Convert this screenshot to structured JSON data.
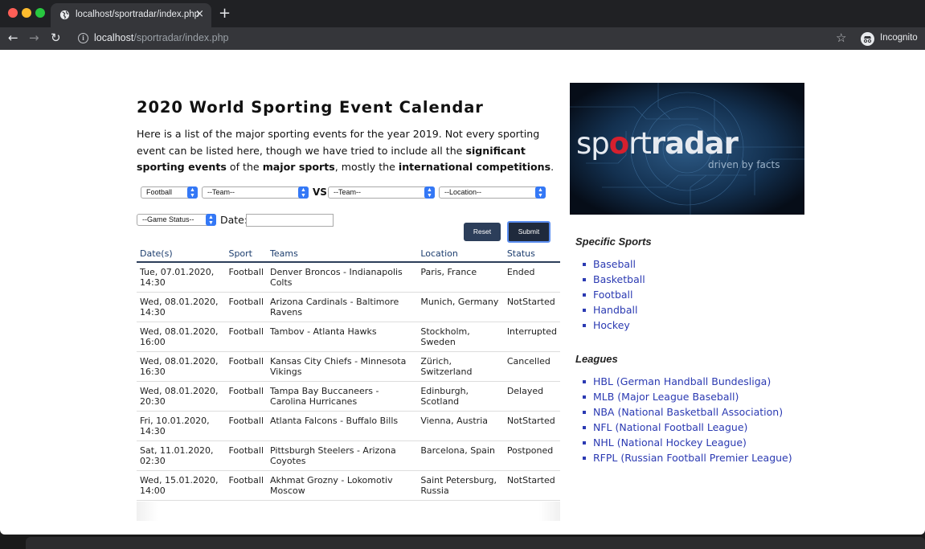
{
  "browser": {
    "tab_title": "localhost/sportradar/index.php",
    "tab_close": "×",
    "new_tab": "+",
    "url_host": "localhost",
    "url_path": "/sportradar/index.php",
    "profile_label": "Incognito"
  },
  "page": {
    "title": "2020 World Sporting Event Calendar",
    "intro_part1": "Here is a list of the major sporting events for the year 2019. Not every sporting event can be listed here, though we have tried to include all the ",
    "intro_bold1": "significant sporting events",
    "intro_part2": " of the ",
    "intro_bold2": "major sports",
    "intro_part3": ", mostly the ",
    "intro_bold3": "international competitions",
    "intro_part4": "."
  },
  "filters": {
    "sport_value": "Football",
    "team1_value": "--Team--",
    "vs_label": "VS",
    "team2_value": "--Team--",
    "location_value": "--Location--",
    "status_value": "--Game Status--",
    "date_label": "Date:",
    "date_value": "",
    "reset_label": "Reset",
    "submit_label": "Submit"
  },
  "table": {
    "headers": [
      "Date(s)",
      "Sport",
      "Teams",
      "Location",
      "Status"
    ],
    "rows": [
      {
        "date": "Tue, 07.01.2020, 14:30",
        "sport": "Football",
        "teams": "Denver Broncos - Indianapolis Colts",
        "location": "Paris, France",
        "status": "Ended"
      },
      {
        "date": "Wed, 08.01.2020, 14:30",
        "sport": "Football",
        "teams": "Arizona Cardinals - Baltimore Ravens",
        "location": "Munich, Germany",
        "status": "NotStarted"
      },
      {
        "date": "Wed, 08.01.2020, 16:00",
        "sport": "Football",
        "teams": "Tambov - Atlanta Hawks",
        "location": "Stockholm, Sweden",
        "status": "Interrupted"
      },
      {
        "date": "Wed, 08.01.2020, 16:30",
        "sport": "Football",
        "teams": "Kansas City Chiefs - Minnesota Vikings",
        "location": "Zürich, Switzerland",
        "status": "Cancelled"
      },
      {
        "date": "Wed, 08.01.2020, 20:30",
        "sport": "Football",
        "teams": "Tampa Bay Buccaneers - Carolina Hurricanes",
        "location": "Edinburgh, Scotland",
        "status": "Delayed"
      },
      {
        "date": "Fri, 10.01.2020, 14:30",
        "sport": "Football",
        "teams": "Atlanta Falcons - Buffalo Bills",
        "location": "Vienna, Austria",
        "status": "NotStarted"
      },
      {
        "date": "Sat, 11.01.2020, 02:30",
        "sport": "Football",
        "teams": "Pittsburgh Steelers - Arizona Coyotes",
        "location": "Barcelona, Spain",
        "status": "Postponed"
      },
      {
        "date": "Wed, 15.01.2020, 14:00",
        "sport": "Football",
        "teams": "Akhmat Grozny - Lokomotiv Moscow",
        "location": "Saint Petersburg, Russia",
        "status": "NotStarted"
      }
    ]
  },
  "sidebar": {
    "logo_text_light": "sp",
    "logo_text_o": "o",
    "logo_text_rt": "rt",
    "logo_text_bold": "radar",
    "logo_tagline": "driven by facts",
    "specific_sports_heading": "Specific Sports",
    "sports": [
      "Baseball",
      "Basketball",
      "Football",
      "Handball",
      "Hockey"
    ],
    "leagues_heading": "Leagues",
    "leagues": [
      "HBL (German Handball Bundesliga)",
      "MLB (Major League Baseball)",
      "NBA (National Basketball Association)",
      "NFL (National Football League)",
      "NHL (National Hockey League)",
      "RFPL (Russian Football Premier League)"
    ]
  },
  "colors": {
    "link": "#2b3ab2",
    "button_dark": "#2c3e5a",
    "header_text": "#1c3d6e",
    "select_arrow": "#3478f6"
  }
}
